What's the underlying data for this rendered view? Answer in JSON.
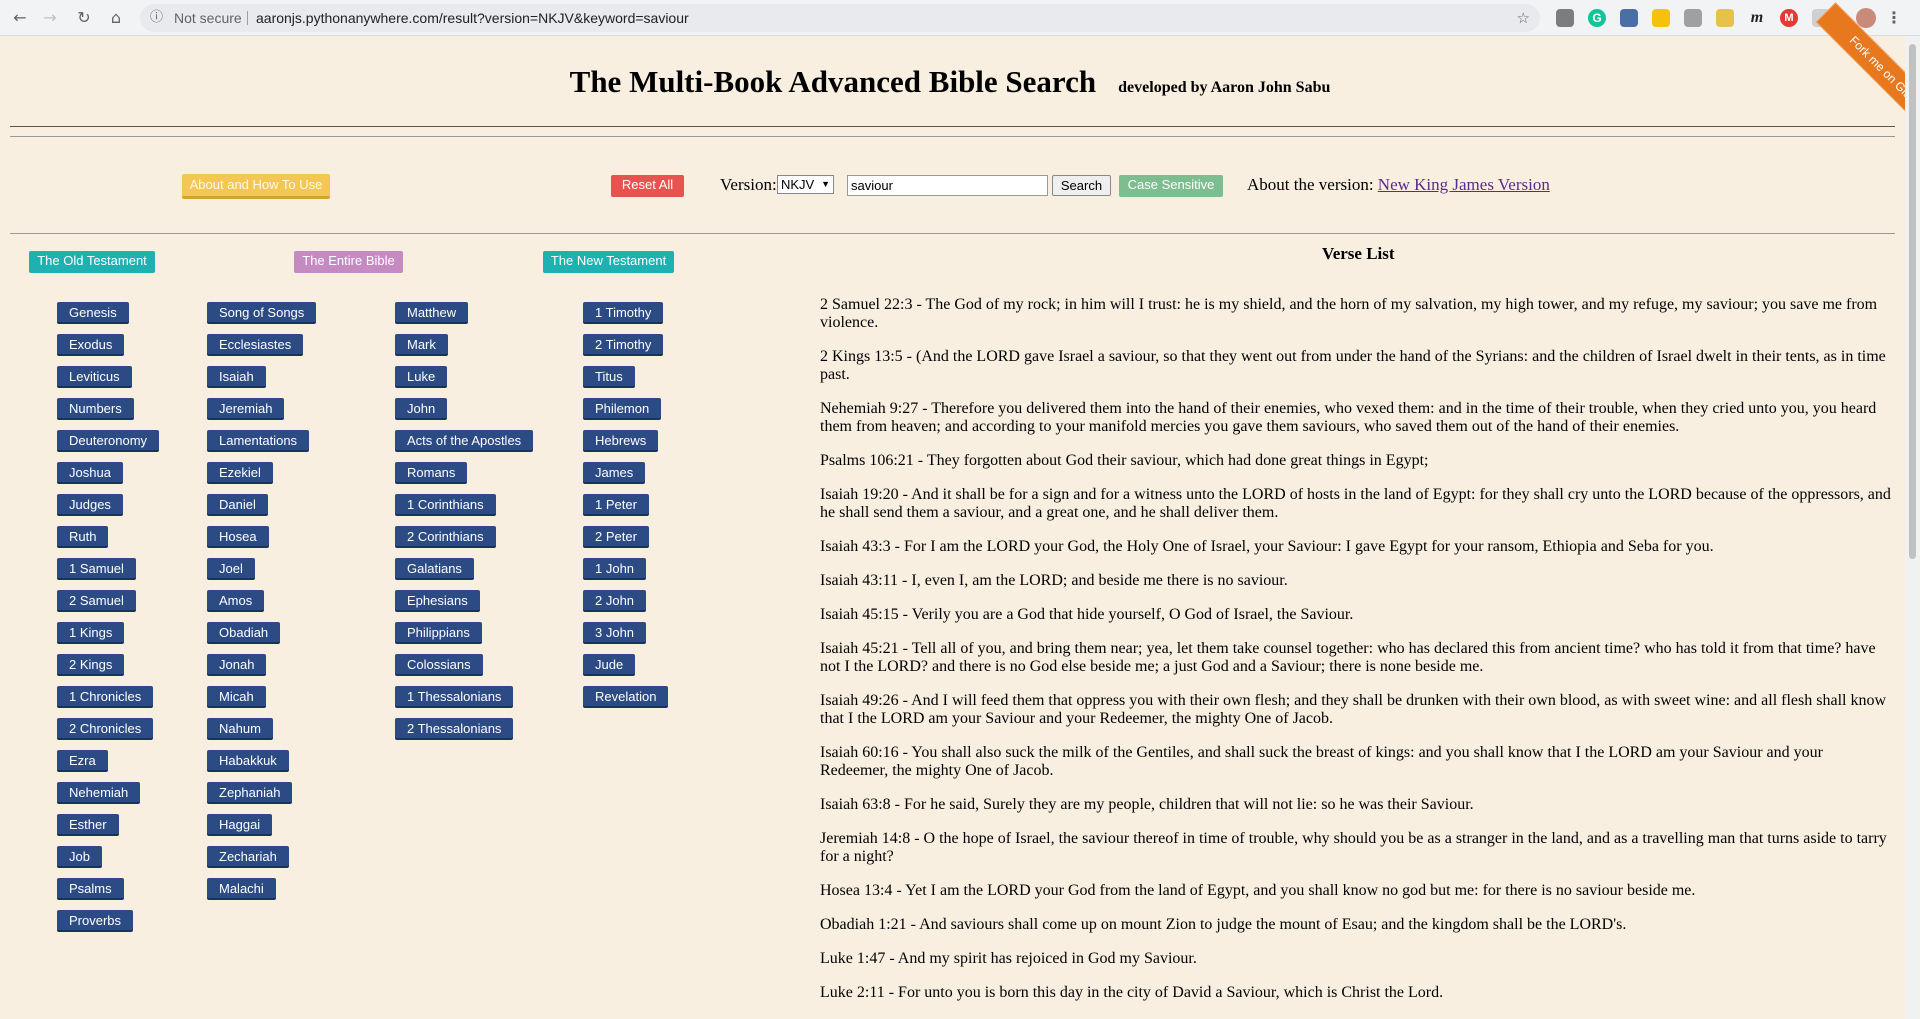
{
  "browser": {
    "security_label": "Not secure",
    "url": "aaronjs.pythonanywhere.com/result?version=NKJV&keyword=saviour"
  },
  "header": {
    "title": "The Multi-Book Advanced Bible Search",
    "subtitle": "developed by Aaron John Sabu",
    "ribbon": "Fork me on GitHub"
  },
  "toolbar": {
    "about_label": "About and How To Use",
    "reset_label": "Reset All",
    "version_label": "Version:",
    "version_value": "NKJV",
    "search_value": "saviour",
    "search_label": "Search",
    "case_label": "Case Sensitive",
    "about_version_label": "About the version:",
    "about_version_link": "New King James Version"
  },
  "categories": {
    "old": "The Old Testament",
    "all": "The Entire Bible",
    "new": "The New Testament"
  },
  "books": {
    "col1": [
      "Genesis",
      "Exodus",
      "Leviticus",
      "Numbers",
      "Deuteronomy",
      "Joshua",
      "Judges",
      "Ruth",
      "1 Samuel",
      "2 Samuel",
      "1 Kings",
      "2 Kings",
      "1 Chronicles",
      "2 Chronicles",
      "Ezra",
      "Nehemiah",
      "Esther",
      "Job",
      "Psalms",
      "Proverbs"
    ],
    "col2": [
      "Song of Songs",
      "Ecclesiastes",
      "Isaiah",
      "Jeremiah",
      "Lamentations",
      "Ezekiel",
      "Daniel",
      "Hosea",
      "Joel",
      "Amos",
      "Obadiah",
      "Jonah",
      "Micah",
      "Nahum",
      "Habakkuk",
      "Zephaniah",
      "Haggai",
      "Zechariah",
      "Malachi"
    ],
    "col3": [
      "Matthew",
      "Mark",
      "Luke",
      "John",
      "Acts of the Apostles",
      "Romans",
      "1 Corinthians",
      "2 Corinthians",
      "Galatians",
      "Ephesians",
      "Philippians",
      "Colossians",
      "1 Thessalonians",
      "2 Thessalonians"
    ],
    "col4": [
      "1 Timothy",
      "2 Timothy",
      "Titus",
      "Philemon",
      "Hebrews",
      "James",
      "1 Peter",
      "2 Peter",
      "1 John",
      "2 John",
      "3 John",
      "Jude",
      "Revelation"
    ]
  },
  "verse_list": {
    "title": "Verse List",
    "verses": [
      "2 Samuel 22:3 - The God of my rock; in him will I trust: he is my shield, and the horn of my salvation, my high tower, and my refuge, my saviour; you save me from violence.",
      "2 Kings 13:5 - (And the LORD gave Israel a saviour, so that they went out from under the hand of the Syrians: and the children of Israel dwelt in their tents, as in time past.",
      "Nehemiah 9:27 - Therefore you delivered them into the hand of their enemies, who vexed them: and in the time of their trouble, when they cried unto you, you heard them from heaven; and according to your manifold mercies you gave them saviours, who saved them out of the hand of their enemies.",
      "Psalms 106:21 - They forgotten about God their saviour, which had done great things in Egypt;",
      "Isaiah 19:20 - And it shall be for a sign and for a witness unto the LORD of hosts in the land of Egypt: for they shall cry unto the LORD because of the oppressors, and he shall send them a saviour, and a great one, and he shall deliver them.",
      "Isaiah 43:3 - For I am the LORD your God, the Holy One of Israel, your Saviour: I gave Egypt for your ransom, Ethiopia and Seba for you.",
      "Isaiah 43:11 - I, even I, am the LORD; and beside me there is no saviour.",
      "Isaiah 45:15 - Verily you are a God that hide yourself, O God of Israel, the Saviour.",
      "Isaiah 45:21 - Tell all of you, and bring them near; yea, let them take counsel together: who has declared this from ancient time? who has told it from that time? have not I the LORD? and there is no God else beside me; a just God and a Saviour; there is none beside me.",
      "Isaiah 49:26 - And I will feed them that oppress you with their own flesh; and they shall be drunken with their own blood, as with sweet wine: and all flesh shall know that I the LORD am your Saviour and your Redeemer, the mighty One of Jacob.",
      "Isaiah 60:16 - You shall also suck the milk of the Gentiles, and shall suck the breast of kings: and you shall know that I the LORD am your Saviour and your Redeemer, the mighty One of Jacob.",
      "Isaiah 63:8 - For he said, Surely they are my people, children that will not lie: so he was their Saviour.",
      "Jeremiah 14:8 - O the hope of Israel, the saviour thereof in time of trouble, why should you be as a stranger in the land, and as a travelling man that turns aside to tarry for a night?",
      "Hosea 13:4 - Yet I am the LORD your God from the land of Egypt, and you shall know no god but me: for there is no saviour beside me.",
      "Obadiah 1:21 - And saviours shall come up on mount Zion to judge the mount of Esau; and the kingdom shall be the LORD's.",
      "Luke 1:47 - And my spirit has rejoiced in God my Saviour.",
      "Luke 2:11 - For unto you is born this day in the city of David a Saviour, which is Christ the Lord."
    ]
  }
}
